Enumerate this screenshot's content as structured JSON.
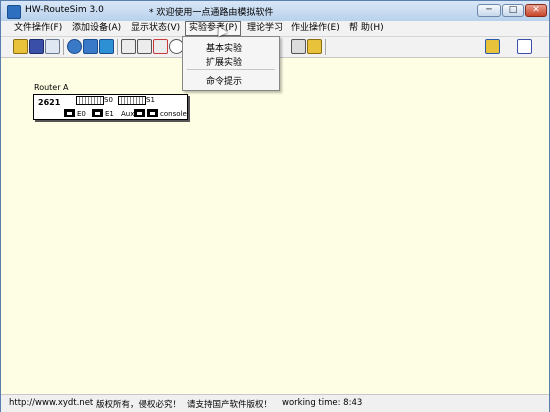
{
  "window": {
    "title": "HW-RouteSim 3.0",
    "message": "* 欢迎使用一点通路由模拟软件",
    "buttons": {
      "minimize": "─",
      "maximize": "□",
      "close": "✕"
    }
  },
  "menubar": {
    "items": [
      {
        "label": "文件操作(F)"
      },
      {
        "label": "添加设备(A)"
      },
      {
        "label": "显示状态(V)"
      },
      {
        "label": "实验参考(P)"
      },
      {
        "label": "理论学习"
      },
      {
        "label": "作业操作(E)"
      },
      {
        "label": "帮  助(H)"
      }
    ]
  },
  "dropdown": {
    "items": [
      {
        "label": "基本实验"
      },
      {
        "label": "扩展实验"
      },
      {
        "label": "命令提示"
      }
    ]
  },
  "toolbar": {
    "icons": [
      "open-folder-icon",
      "save-icon",
      "undo-icon",
      "router-icon",
      "router2-icon",
      "pc-icon",
      "device-a-icon",
      "device-b-icon",
      "device-c-icon",
      "zoom-icon",
      "device-d-icon",
      "link-icon",
      "key-icon",
      "export-icon",
      "exit-icon"
    ],
    "colors": {
      "blue": "#3a79c8",
      "yellow": "#e8c23a",
      "red": "#c83a3a",
      "green": "#3aa84a"
    }
  },
  "canvas": {
    "background": "#fefee4",
    "router": {
      "name": "Router A",
      "model": "2621",
      "serial_ports": [
        "S0",
        "S1"
      ],
      "eth_ports": [
        "E0",
        "E1",
        "Aux",
        "console"
      ]
    }
  },
  "statusbar": {
    "url": "http://www.xydt.net",
    "copyright": "版权所有，侵权必究！",
    "support": "请支持国产软件版权！",
    "working_time": "working time: 8:43"
  }
}
